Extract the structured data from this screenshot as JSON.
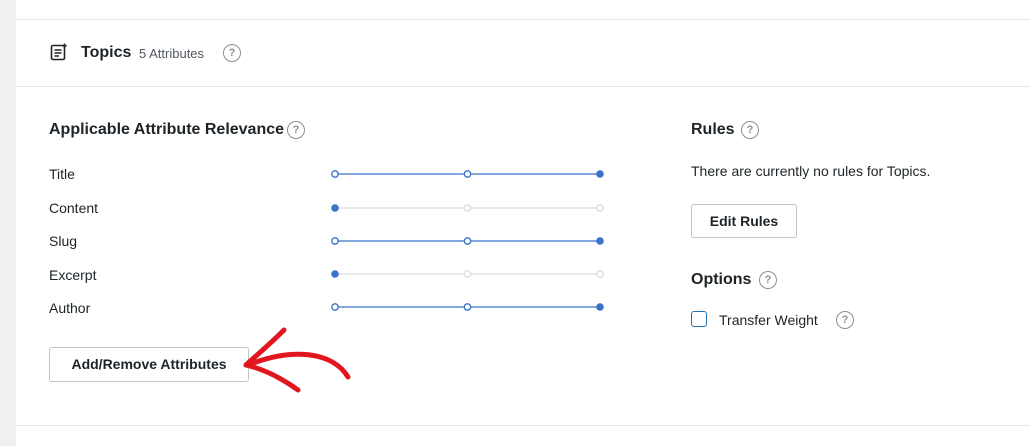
{
  "topic": {
    "title": "Topics",
    "count": "5 Attributes",
    "icon": "document-list-icon"
  },
  "relevance": {
    "title": "Applicable Attribute Relevance",
    "attributes": [
      {
        "label": "Title",
        "level": 1.0
      },
      {
        "label": "Content",
        "level": 0.0
      },
      {
        "label": "Slug",
        "level": 1.0
      },
      {
        "label": "Excerpt",
        "level": 0.0
      },
      {
        "label": "Author",
        "level": 1.0
      }
    ],
    "button_label": "Add/Remove Attributes"
  },
  "rules": {
    "title": "Rules",
    "empty_text": "There are currently no rules for Topics.",
    "button_label": "Edit Rules"
  },
  "options": {
    "title": "Options",
    "transfer_weight_label": "Transfer Weight",
    "transfer_weight_checked": false
  },
  "help_glyph": "?",
  "colors": {
    "accent": "#3872c9",
    "inactive": "#dcdcde",
    "annotation": "#e2161e"
  }
}
